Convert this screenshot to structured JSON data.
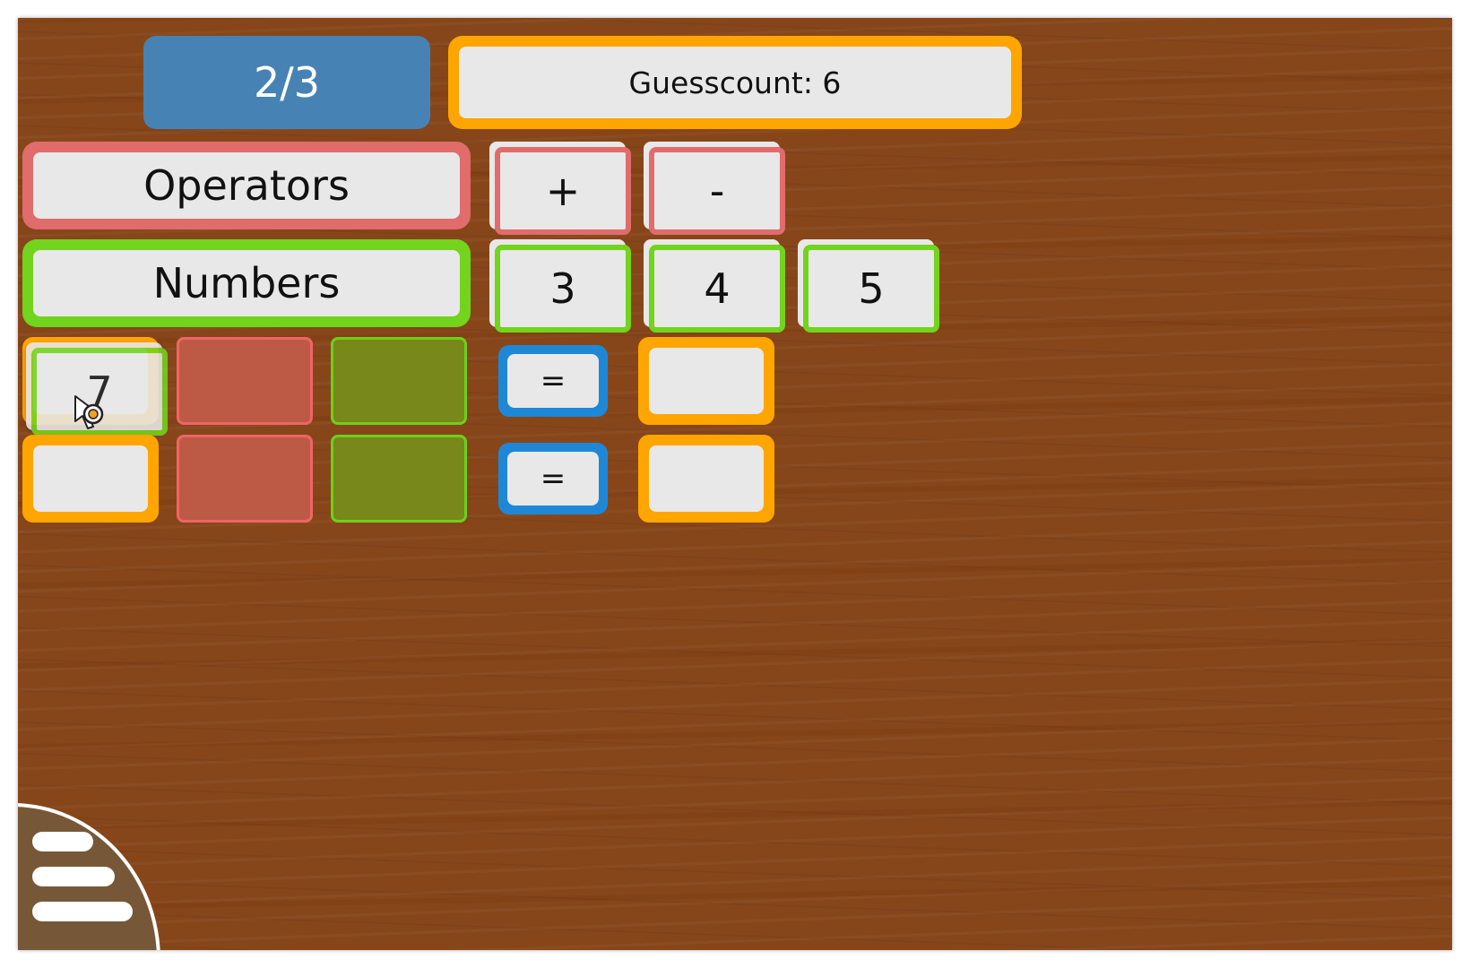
{
  "header": {
    "progress": "2/3",
    "guesscount_label": "Guesscount: 6"
  },
  "categories": {
    "operators_label": "Operators",
    "numbers_label": "Numbers"
  },
  "operators": [
    "+",
    "-"
  ],
  "numbers": [
    "3",
    "4",
    "5"
  ],
  "equations": [
    {
      "first": "7",
      "equals": "="
    },
    {
      "first": "",
      "equals": "="
    }
  ],
  "cursor": {
    "icon": "hand-cursor-icon"
  },
  "menu": {
    "icon": "hamburger-menu-icon"
  },
  "colors": {
    "board": "#87461a",
    "operator_accent": "#e06c6c",
    "number_accent": "#72d41c",
    "result_accent": "#ffa500",
    "equals_accent": "#1e88d6",
    "progress_bg": "#4683b4"
  }
}
